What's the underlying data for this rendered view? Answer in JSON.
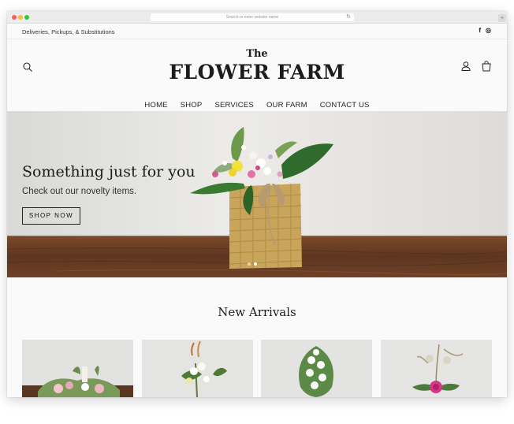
{
  "browser": {
    "url_placeholder": "Search or enter website name",
    "reload_icon": "reload-icon",
    "new_tab": "+"
  },
  "topbar": {
    "text": "Deliveries, Pickups, & Substitutions",
    "social": [
      "f",
      "◎"
    ],
    "social_icons": [
      "facebook-icon",
      "instagram-icon"
    ]
  },
  "header": {
    "logo_the": "The",
    "logo_main": "FLOWER FARM",
    "icons": [
      "search-icon",
      "account-icon",
      "cart-icon"
    ]
  },
  "nav": {
    "items": [
      "HOME",
      "SHOP",
      "SERVICES",
      "OUR FARM",
      "CONTACT US"
    ]
  },
  "hero": {
    "title": "Something just for you",
    "subtitle": "Check out our novelty items.",
    "button": "SHOP NOW",
    "slide_count": 2,
    "active_slide": 2
  },
  "section": {
    "title": "New Arrivals"
  },
  "colors": {
    "page_bg": "#fafafa",
    "text": "#1c1c1c",
    "table_wood": "#6b3f24"
  }
}
